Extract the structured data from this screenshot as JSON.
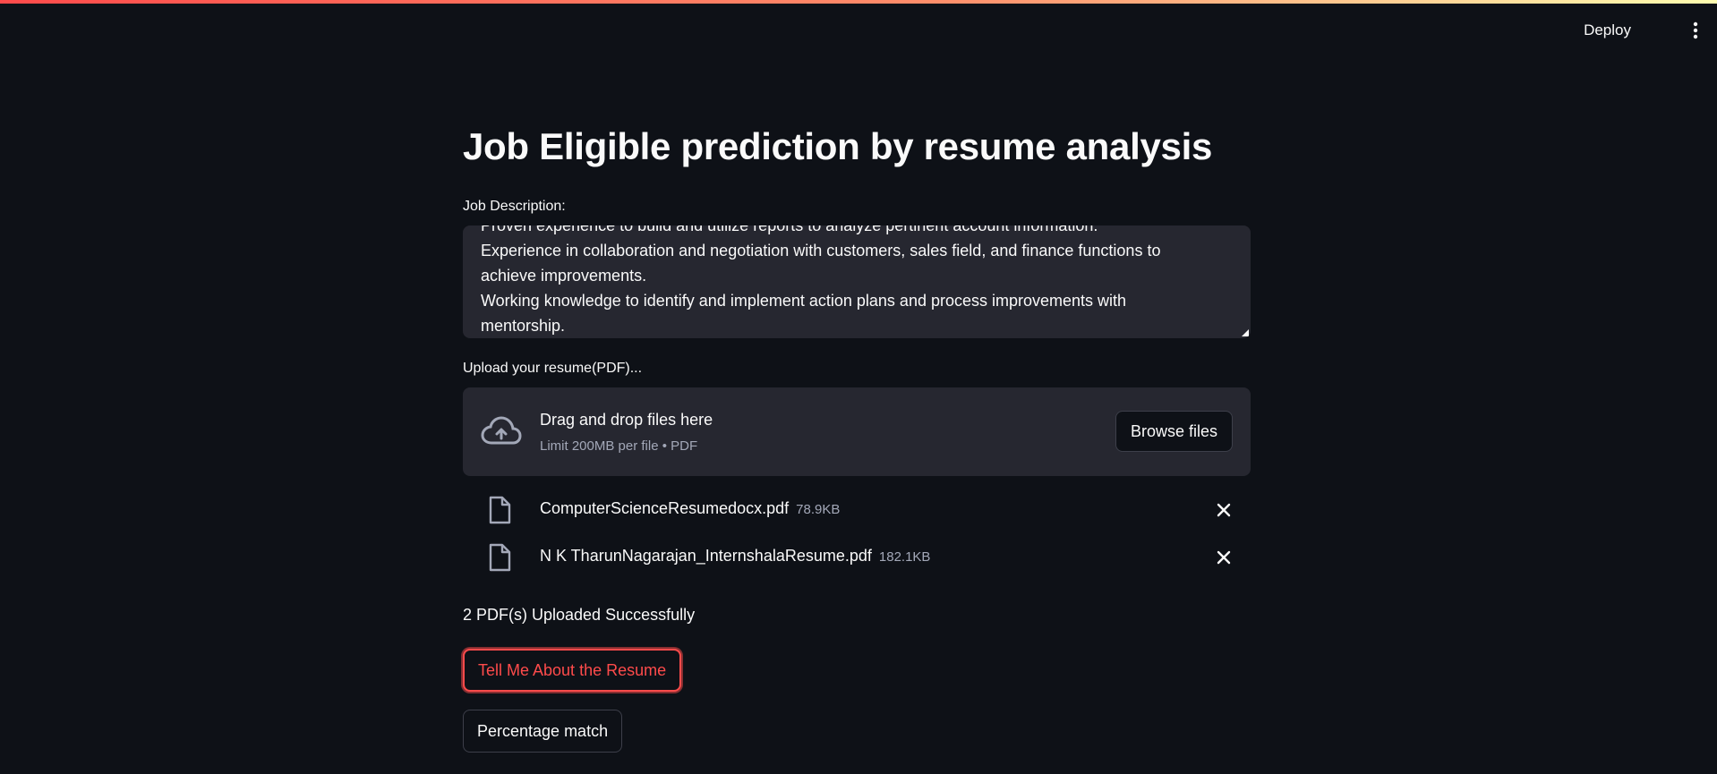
{
  "header": {
    "deploy_label": "Deploy",
    "menu_icon": "vertical-ellipsis-icon"
  },
  "page": {
    "title": "Job Eligible prediction by resume analysis"
  },
  "job_description": {
    "label": "Job Description:",
    "value": "Proven experience to build and utilize reports to analyze pertinent account information.\nExperience in collaboration and negotiation with customers, sales field, and finance functions to achieve improvements.\nWorking knowledge to identify and implement action plans and process improvements with mentorship."
  },
  "uploader": {
    "label": "Upload your resume(PDF)...",
    "drop_title": "Drag and drop files here",
    "drop_limit": "Limit 200MB per file • PDF",
    "browse_label": "Browse files",
    "icon": "cloud-upload-icon"
  },
  "files": [
    {
      "name": "ComputerScienceResumedocx.pdf",
      "size": "78.9KB"
    },
    {
      "name": "N K TharunNagarajan_InternshalaResume.pdf",
      "size": "182.1KB"
    }
  ],
  "status": {
    "message": "2 PDF(s) Uploaded Successfully"
  },
  "actions": {
    "tell_me_label": "Tell Me About the Resume",
    "percentage_label": "Percentage match"
  },
  "colors": {
    "background": "#0e1117",
    "surface": "#262730",
    "accent": "#ff4b4b",
    "text": "#fafafa",
    "muted": "#a3a8b8"
  }
}
